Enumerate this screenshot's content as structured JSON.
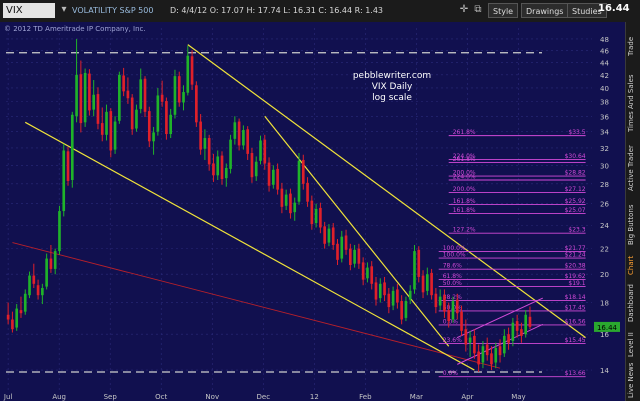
{
  "toolbar": {
    "symbol": "VIX",
    "symbol_desc": "VOLATILITY S&P 500",
    "ohlc": "D: 4/4/12  O: 17.07  H: 17.74  L: 16.31  C: 16.44  R: 1.43",
    "copyright": "© 2012 TD Ameritrade IP Company, Inc.",
    "buttons": [
      "Style",
      "Drawings",
      "Studies"
    ],
    "last_price": "16.44"
  },
  "sidebar_tabs": [
    "Trade",
    "Times And Sales",
    "Active Trader",
    "Big Buttons",
    "Chart",
    "Dashboard",
    "Level II",
    "Live News"
  ],
  "annotation": [
    "pebblewriter.com",
    "VIX Daily",
    "log scale"
  ],
  "colors": {
    "background": "#11104f",
    "grid": "#2b2a7a",
    "up_candle": "#1fb32a",
    "down_candle": "#e0202a",
    "trendline": "#f0e33a",
    "fib": "#d24ad8",
    "red_line": "#b8202a",
    "dashed_line": "#cfcfcf"
  },
  "chart_data": {
    "type": "candlestick",
    "scale": "log",
    "ylim": [
      13,
      50
    ],
    "y_ticks": [
      14,
      16,
      18,
      20,
      22,
      24,
      26,
      28,
      30,
      32,
      34,
      36,
      38,
      40,
      42,
      44,
      46,
      48
    ],
    "x_labels": [
      "Jul",
      "Aug",
      "Sep",
      "Oct",
      "Nov",
      "Dec",
      "12",
      "Feb",
      "Mar",
      "Apr",
      "May"
    ],
    "last_price": 16.44,
    "candles": [
      {
        "o": 17.2,
        "h": 18.0,
        "l": 16.6,
        "c": 16.9
      },
      {
        "o": 16.9,
        "h": 17.4,
        "l": 16.1,
        "c": 16.3
      },
      {
        "o": 16.4,
        "h": 17.9,
        "l": 16.2,
        "c": 17.6
      },
      {
        "o": 17.5,
        "h": 18.4,
        "l": 17.0,
        "c": 17.3
      },
      {
        "o": 17.4,
        "h": 18.9,
        "l": 17.2,
        "c": 18.6
      },
      {
        "o": 18.5,
        "h": 20.2,
        "l": 18.3,
        "c": 19.9
      },
      {
        "o": 19.9,
        "h": 20.8,
        "l": 19.0,
        "c": 19.3
      },
      {
        "o": 19.2,
        "h": 19.6,
        "l": 18.2,
        "c": 18.5
      },
      {
        "o": 18.5,
        "h": 19.3,
        "l": 17.9,
        "c": 19.0
      },
      {
        "o": 19.1,
        "h": 21.6,
        "l": 18.9,
        "c": 21.2
      },
      {
        "o": 21.2,
        "h": 22.3,
        "l": 20.1,
        "c": 20.4
      },
      {
        "o": 20.4,
        "h": 22.0,
        "l": 20.0,
        "c": 21.8
      },
      {
        "o": 21.8,
        "h": 25.8,
        "l": 21.5,
        "c": 25.3
      },
      {
        "o": 25.3,
        "h": 32.5,
        "l": 24.8,
        "c": 31.7
      },
      {
        "o": 31.6,
        "h": 32.1,
        "l": 27.8,
        "c": 28.3
      },
      {
        "o": 28.4,
        "h": 36.6,
        "l": 27.6,
        "c": 36.2
      },
      {
        "o": 36.0,
        "h": 48.0,
        "l": 35.2,
        "c": 42.0
      },
      {
        "o": 42.1,
        "h": 44.3,
        "l": 33.9,
        "c": 35.1
      },
      {
        "o": 35.2,
        "h": 43.0,
        "l": 34.6,
        "c": 42.3
      },
      {
        "o": 42.2,
        "h": 42.9,
        "l": 36.1,
        "c": 36.8
      },
      {
        "o": 36.9,
        "h": 41.2,
        "l": 36.0,
        "c": 39.0
      },
      {
        "o": 39.1,
        "h": 40.1,
        "l": 34.3,
        "c": 35.0
      },
      {
        "o": 35.1,
        "h": 37.2,
        "l": 32.8,
        "c": 33.6
      },
      {
        "o": 33.6,
        "h": 37.6,
        "l": 32.9,
        "c": 36.6
      },
      {
        "o": 36.7,
        "h": 37.1,
        "l": 30.9,
        "c": 31.7
      },
      {
        "o": 31.8,
        "h": 36.0,
        "l": 31.3,
        "c": 35.3
      },
      {
        "o": 35.4,
        "h": 42.5,
        "l": 35.0,
        "c": 42.0
      },
      {
        "o": 41.9,
        "h": 43.1,
        "l": 38.8,
        "c": 39.5
      },
      {
        "o": 39.6,
        "h": 41.6,
        "l": 37.7,
        "c": 38.5
      },
      {
        "o": 38.6,
        "h": 39.1,
        "l": 33.6,
        "c": 34.3
      },
      {
        "o": 34.4,
        "h": 37.6,
        "l": 34.0,
        "c": 36.9
      },
      {
        "o": 37.0,
        "h": 43.0,
        "l": 36.4,
        "c": 41.3
      },
      {
        "o": 41.4,
        "h": 41.8,
        "l": 35.9,
        "c": 36.6
      },
      {
        "o": 36.7,
        "h": 37.3,
        "l": 32.1,
        "c": 32.8
      },
      {
        "o": 32.8,
        "h": 34.6,
        "l": 31.2,
        "c": 33.9
      },
      {
        "o": 34.0,
        "h": 40.0,
        "l": 33.5,
        "c": 38.9
      },
      {
        "o": 39.0,
        "h": 41.1,
        "l": 37.3,
        "c": 38.0
      },
      {
        "o": 38.1,
        "h": 38.6,
        "l": 33.0,
        "c": 33.7
      },
      {
        "o": 33.7,
        "h": 37.0,
        "l": 33.2,
        "c": 36.2
      },
      {
        "o": 36.2,
        "h": 42.8,
        "l": 35.7,
        "c": 41.8
      },
      {
        "o": 41.8,
        "h": 42.5,
        "l": 37.3,
        "c": 37.9
      },
      {
        "o": 37.9,
        "h": 40.4,
        "l": 36.8,
        "c": 39.4
      },
      {
        "o": 39.3,
        "h": 46.8,
        "l": 38.9,
        "c": 45.1
      },
      {
        "o": 45.0,
        "h": 46.0,
        "l": 39.7,
        "c": 40.5
      },
      {
        "o": 40.4,
        "h": 41.0,
        "l": 34.6,
        "c": 35.2
      },
      {
        "o": 35.3,
        "h": 36.3,
        "l": 31.2,
        "c": 31.8
      },
      {
        "o": 31.9,
        "h": 34.3,
        "l": 30.6,
        "c": 33.2
      },
      {
        "o": 33.2,
        "h": 33.6,
        "l": 29.4,
        "c": 30.1
      },
      {
        "o": 30.2,
        "h": 31.3,
        "l": 28.2,
        "c": 28.9
      },
      {
        "o": 28.9,
        "h": 31.7,
        "l": 28.4,
        "c": 31.0
      },
      {
        "o": 31.1,
        "h": 31.6,
        "l": 27.9,
        "c": 28.5
      },
      {
        "o": 28.6,
        "h": 30.2,
        "l": 27.7,
        "c": 29.7
      },
      {
        "o": 29.6,
        "h": 33.6,
        "l": 29.1,
        "c": 33.0
      },
      {
        "o": 33.1,
        "h": 36.0,
        "l": 32.4,
        "c": 35.2
      },
      {
        "o": 35.3,
        "h": 35.7,
        "l": 31.7,
        "c": 32.3
      },
      {
        "o": 32.3,
        "h": 34.8,
        "l": 31.8,
        "c": 34.2
      },
      {
        "o": 34.3,
        "h": 34.7,
        "l": 30.6,
        "c": 31.3
      },
      {
        "o": 31.4,
        "h": 32.0,
        "l": 28.1,
        "c": 28.7
      },
      {
        "o": 28.8,
        "h": 31.0,
        "l": 28.3,
        "c": 30.4
      },
      {
        "o": 30.5,
        "h": 33.5,
        "l": 30.1,
        "c": 32.9
      },
      {
        "o": 33.0,
        "h": 33.6,
        "l": 29.5,
        "c": 30.2
      },
      {
        "o": 30.3,
        "h": 30.9,
        "l": 27.2,
        "c": 27.8
      },
      {
        "o": 27.9,
        "h": 30.0,
        "l": 27.5,
        "c": 29.5
      },
      {
        "o": 29.6,
        "h": 30.2,
        "l": 26.9,
        "c": 27.4
      },
      {
        "o": 27.5,
        "h": 28.1,
        "l": 25.1,
        "c": 25.7
      },
      {
        "o": 25.8,
        "h": 27.4,
        "l": 25.4,
        "c": 26.9
      },
      {
        "o": 27.0,
        "h": 27.5,
        "l": 24.6,
        "c": 25.1
      },
      {
        "o": 25.2,
        "h": 26.6,
        "l": 24.4,
        "c": 26.1
      },
      {
        "o": 26.2,
        "h": 31.4,
        "l": 25.9,
        "c": 30.5
      },
      {
        "o": 30.6,
        "h": 31.2,
        "l": 27.4,
        "c": 28.0
      },
      {
        "o": 28.1,
        "h": 28.7,
        "l": 25.7,
        "c": 26.2
      },
      {
        "o": 26.3,
        "h": 26.8,
        "l": 23.6,
        "c": 24.1
      },
      {
        "o": 24.2,
        "h": 26.0,
        "l": 23.8,
        "c": 25.5
      },
      {
        "o": 25.6,
        "h": 26.1,
        "l": 23.3,
        "c": 23.8
      },
      {
        "o": 23.9,
        "h": 24.3,
        "l": 22.0,
        "c": 22.4
      },
      {
        "o": 22.5,
        "h": 24.1,
        "l": 22.2,
        "c": 23.7
      },
      {
        "o": 23.8,
        "h": 24.2,
        "l": 21.9,
        "c": 22.3
      },
      {
        "o": 22.4,
        "h": 22.8,
        "l": 20.7,
        "c": 21.1
      },
      {
        "o": 21.2,
        "h": 23.5,
        "l": 20.9,
        "c": 23.0
      },
      {
        "o": 23.1,
        "h": 23.6,
        "l": 21.5,
        "c": 21.9
      },
      {
        "o": 22.0,
        "h": 22.4,
        "l": 20.3,
        "c": 20.7
      },
      {
        "o": 20.8,
        "h": 22.3,
        "l": 20.5,
        "c": 21.9
      },
      {
        "o": 22.0,
        "h": 22.4,
        "l": 20.4,
        "c": 20.8
      },
      {
        "o": 20.9,
        "h": 21.3,
        "l": 19.2,
        "c": 19.6
      },
      {
        "o": 19.7,
        "h": 20.9,
        "l": 19.4,
        "c": 20.5
      },
      {
        "o": 20.6,
        "h": 21.0,
        "l": 18.9,
        "c": 19.3
      },
      {
        "o": 19.4,
        "h": 19.8,
        "l": 17.8,
        "c": 18.2
      },
      {
        "o": 18.3,
        "h": 19.7,
        "l": 18.0,
        "c": 19.3
      },
      {
        "o": 19.4,
        "h": 19.8,
        "l": 18.1,
        "c": 18.5
      },
      {
        "o": 18.6,
        "h": 19.0,
        "l": 17.3,
        "c": 17.7
      },
      {
        "o": 17.8,
        "h": 19.1,
        "l": 17.5,
        "c": 18.8
      },
      {
        "o": 18.9,
        "h": 19.3,
        "l": 17.6,
        "c": 18.0
      },
      {
        "o": 18.1,
        "h": 18.5,
        "l": 16.6,
        "c": 16.9
      },
      {
        "o": 17.0,
        "h": 18.4,
        "l": 16.8,
        "c": 18.1
      },
      {
        "o": 18.2,
        "h": 19.2,
        "l": 17.9,
        "c": 18.8
      },
      {
        "o": 18.9,
        "h": 22.3,
        "l": 18.6,
        "c": 21.8
      },
      {
        "o": 21.9,
        "h": 22.2,
        "l": 19.4,
        "c": 19.8
      },
      {
        "o": 19.9,
        "h": 20.3,
        "l": 18.3,
        "c": 18.7
      },
      {
        "o": 18.8,
        "h": 20.5,
        "l": 18.5,
        "c": 20.0
      },
      {
        "o": 20.1,
        "h": 20.4,
        "l": 18.2,
        "c": 18.5
      },
      {
        "o": 18.6,
        "h": 19.0,
        "l": 17.3,
        "c": 17.7
      },
      {
        "o": 17.8,
        "h": 18.9,
        "l": 17.5,
        "c": 18.4
      },
      {
        "o": 18.5,
        "h": 18.9,
        "l": 17.0,
        "c": 17.4
      },
      {
        "o": 17.5,
        "h": 18.0,
        "l": 16.4,
        "c": 16.8
      },
      {
        "o": 16.9,
        "h": 18.4,
        "l": 16.7,
        "c": 18.1
      },
      {
        "o": 18.2,
        "h": 18.6,
        "l": 16.9,
        "c": 17.3
      },
      {
        "o": 17.4,
        "h": 17.8,
        "l": 15.9,
        "c": 16.2
      },
      {
        "o": 16.3,
        "h": 16.9,
        "l": 15.0,
        "c": 15.4
      },
      {
        "o": 15.5,
        "h": 16.2,
        "l": 14.7,
        "c": 15.8
      },
      {
        "o": 15.9,
        "h": 16.3,
        "l": 14.6,
        "c": 14.9
      },
      {
        "o": 15.0,
        "h": 15.4,
        "l": 13.9,
        "c": 14.3
      },
      {
        "o": 14.4,
        "h": 15.6,
        "l": 14.1,
        "c": 15.3
      },
      {
        "o": 15.4,
        "h": 15.8,
        "l": 14.5,
        "c": 14.8
      },
      {
        "o": 14.9,
        "h": 15.3,
        "l": 14.0,
        "c": 14.3
      },
      {
        "o": 14.4,
        "h": 15.5,
        "l": 14.1,
        "c": 15.2
      },
      {
        "o": 15.3,
        "h": 15.7,
        "l": 14.4,
        "c": 14.8
      },
      {
        "o": 14.9,
        "h": 16.3,
        "l": 14.7,
        "c": 15.9
      },
      {
        "o": 16.0,
        "h": 16.4,
        "l": 15.1,
        "c": 15.5
      },
      {
        "o": 15.6,
        "h": 17.0,
        "l": 15.3,
        "c": 16.7
      },
      {
        "o": 16.8,
        "h": 17.2,
        "l": 15.8,
        "c": 16.2
      },
      {
        "o": 16.3,
        "h": 16.7,
        "l": 15.5,
        "c": 15.9
      },
      {
        "o": 16.0,
        "h": 17.5,
        "l": 15.8,
        "c": 17.2
      },
      {
        "o": 17.07,
        "h": 17.74,
        "l": 16.31,
        "c": 16.44
      }
    ],
    "fib_levels": [
      {
        "pct": "261.8%",
        "value": "$33.5",
        "y": 33.5
      },
      {
        "pct": "224.0%",
        "value": "$30.64",
        "y": 30.64
      },
      {
        "pct": "261.8%",
        "value": "",
        "y": 30.3
      },
      {
        "pct": "200.0%",
        "value": "$28.82",
        "y": 28.82
      },
      {
        "pct": "224.0%",
        "value": "",
        "y": 28.4
      },
      {
        "pct": "200.0%",
        "value": "$27.12",
        "y": 27.12
      },
      {
        "pct": "161.8%",
        "value": "$25.92",
        "y": 25.92
      },
      {
        "pct": "161.8%",
        "value": "$25.07",
        "y": 25.07
      },
      {
        "pct": "127.2%",
        "value": "$23.3",
        "y": 23.3
      },
      {
        "pct": "100.0%",
        "value": "$21.77",
        "y": 21.77
      },
      {
        "pct": "100.0%",
        "value": "$21.24",
        "y": 21.24
      },
      {
        "pct": "78.6%",
        "value": "$20.38",
        "y": 20.38
      },
      {
        "pct": "61.8%",
        "value": "$19.62",
        "y": 19.62
      },
      {
        "pct": "50.0%",
        "value": "$19.1",
        "y": 19.1
      },
      {
        "pct": "38.2%",
        "value": "$18.14",
        "y": 18.14
      },
      {
        "pct": "50.0%",
        "value": "$17.45",
        "y": 17.45
      },
      {
        "pct": "0.0%",
        "value": "$16.56",
        "y": 16.56
      },
      {
        "pct": "23.6%",
        "value": "$15.45",
        "y": 15.45
      },
      {
        "pct": "0.0%",
        "value": "$13.66",
        "y": 13.66
      }
    ]
  }
}
